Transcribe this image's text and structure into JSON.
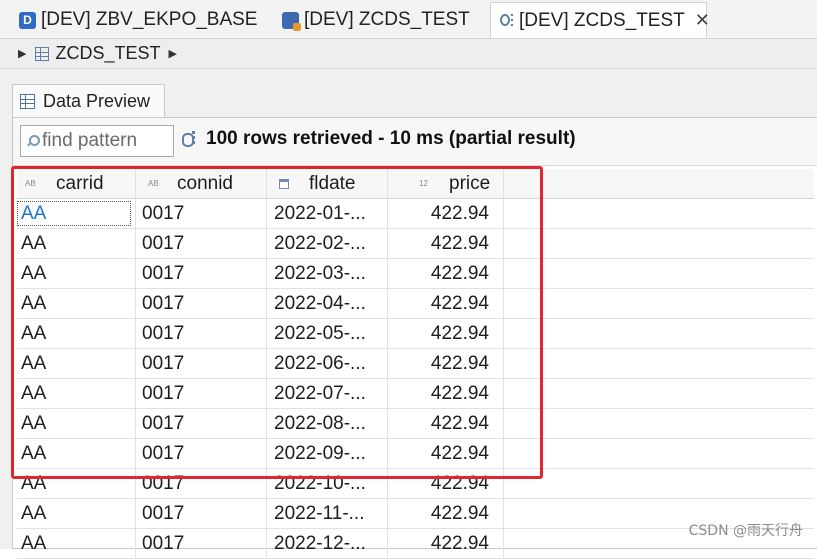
{
  "editor_tabs": [
    {
      "label": "[DEV] ZBV_EKPO_BASE",
      "icon": "ddic-icon",
      "icon_letter": "D"
    },
    {
      "label": "[DEV] ZCDS_TEST",
      "icon": "cds-view-icon"
    },
    {
      "label": "[DEV] ZCDS_TEST",
      "icon": "data-preview-icon",
      "close": "✕"
    }
  ],
  "breadcrumb": {
    "item": "ZCDS_TEST",
    "icon": "table-icon"
  },
  "view_tab": {
    "label": "Data Preview",
    "icon": "table-icon"
  },
  "filter": {
    "placeholder": "find pattern"
  },
  "status": {
    "text": "100 rows retrieved - 10 ms (partial result)"
  },
  "table": {
    "columns": [
      {
        "label": "carrid",
        "type_indicator": "AB"
      },
      {
        "label": "connid",
        "type_indicator": "AB"
      },
      {
        "label": "fldate",
        "type_indicator": "calendar-icon"
      },
      {
        "label": "price",
        "type_indicator": "12"
      }
    ],
    "rows": [
      [
        "AA",
        "0017",
        "2022-01-...",
        "422.94"
      ],
      [
        "AA",
        "0017",
        "2022-02-...",
        "422.94"
      ],
      [
        "AA",
        "0017",
        "2022-03-...",
        "422.94"
      ],
      [
        "AA",
        "0017",
        "2022-04-...",
        "422.94"
      ],
      [
        "AA",
        "0017",
        "2022-05-...",
        "422.94"
      ],
      [
        "AA",
        "0017",
        "2022-06-...",
        "422.94"
      ],
      [
        "AA",
        "0017",
        "2022-07-...",
        "422.94"
      ],
      [
        "AA",
        "0017",
        "2022-08-...",
        "422.94"
      ],
      [
        "AA",
        "0017",
        "2022-09-...",
        "422.94"
      ],
      [
        "AA",
        "0017",
        "2022-10-...",
        "422.94"
      ],
      [
        "AA",
        "0017",
        "2022-11-...",
        "422.94"
      ],
      [
        "AA",
        "0017",
        "2022-12-...",
        "422.94"
      ]
    ]
  },
  "highlight_color": "#e0262f",
  "watermark": "CSDN @雨天行舟"
}
